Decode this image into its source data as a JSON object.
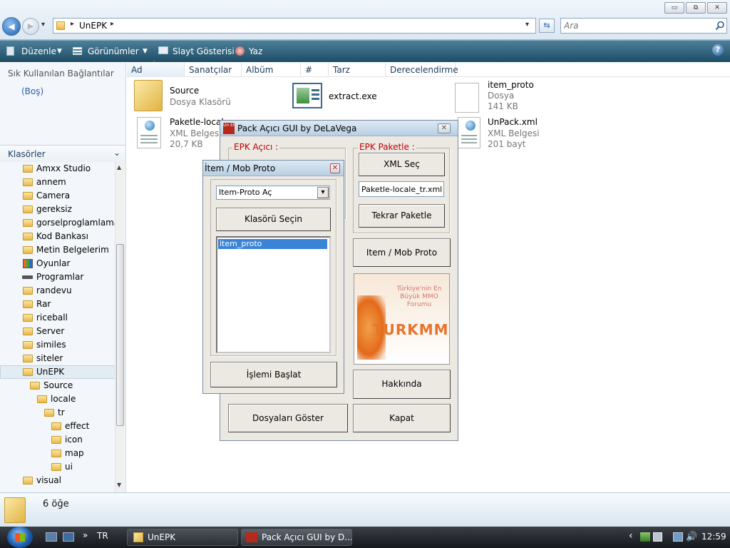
{
  "explorer": {
    "window_controls": {
      "minimize": "▭",
      "maximize": "⧉",
      "close": "✕"
    },
    "nav": {
      "back": "◀",
      "forward": "▶",
      "history": "▾",
      "refresh": "⇆"
    },
    "address": {
      "folder_icon": "folder-icon",
      "path": "UnEPK",
      "chevron": "▸"
    },
    "search": {
      "placeholder": "Ara"
    },
    "toolbar": {
      "organize": "Düzenle",
      "views": "Görünümler",
      "slideshow": "Slayt Gösterisi",
      "print": "Yaz",
      "help": "?"
    },
    "sidebar": {
      "favorites_title": "Sık Kullanılan Bağlantılar",
      "favorites_empty": "(Boş)",
      "folders_title": "Klasörler",
      "tree": [
        {
          "label": "Amxx Studio"
        },
        {
          "label": "annem"
        },
        {
          "label": "Camera"
        },
        {
          "label": "gereksiz"
        },
        {
          "label": "gorselproglamlama"
        },
        {
          "label": "Kod Bankası"
        },
        {
          "label": "Metin Belgelerim"
        },
        {
          "label": "Oyunlar"
        },
        {
          "label": "Programlar"
        },
        {
          "label": "randevu"
        },
        {
          "label": "Rar"
        },
        {
          "label": "riceball"
        },
        {
          "label": "Server"
        },
        {
          "label": "similes"
        },
        {
          "label": "siteler"
        },
        {
          "label": "UnEPK"
        },
        {
          "label": "Source"
        },
        {
          "label": "locale"
        },
        {
          "label": "tr"
        },
        {
          "label": "effect"
        },
        {
          "label": "icon"
        },
        {
          "label": "map"
        },
        {
          "label": "ui"
        },
        {
          "label": "visual"
        }
      ]
    },
    "columns": [
      "Ad",
      "Sanatçılar",
      "Albüm",
      "#",
      "Tarz",
      "Derecelendirme"
    ],
    "files": [
      {
        "name": "Source",
        "type": "Dosya Klasörü",
        "size": ""
      },
      {
        "name": "extract.exe",
        "type": "",
        "size": ""
      },
      {
        "name": "item_proto",
        "type": "Dosya",
        "size": "141 KB"
      },
      {
        "name": "Paketle-locale",
        "type": "XML Belgesi",
        "size": "20,7 KB"
      },
      {
        "name": "UnPack.xml",
        "type": "XML Belgesi",
        "size": "201 bayt"
      }
    ],
    "status": {
      "count": "6 öğe"
    }
  },
  "pack_dialog": {
    "title": "Pack Açıcı GUI by DeLaVega",
    "icon_text": "Un EPK",
    "close": "✕",
    "epk_open_label": "EPK Açıcı :",
    "epk_pack_label": "EPK Paketle :",
    "xml_select": "XML Seç",
    "xml_field": "Paketle-locale_tr.xml",
    "repack": "Tekrar Paketle",
    "item_mob": "Item / Mob Proto",
    "banner": {
      "top": "Türkiye'nin En Büyük MMO Forumu",
      "brand": "TURKMMO"
    },
    "about": "Hakkında",
    "show_files": "Dosyaları Göster",
    "close_btn": "Kapat"
  },
  "proto_dialog": {
    "title": "İtem / Mob Proto",
    "close": "✕",
    "combo_value": "Item-Proto Aç",
    "combo_arrow": "▾",
    "select_folder": "Klasörü Seçin",
    "list_items": [
      "item_proto"
    ],
    "start": "İşlemi Başlat"
  },
  "taskbar": {
    "start_icon": "windows-orb-icon",
    "quick_more": "»",
    "lang": "TR",
    "tasks": [
      {
        "label": "UnEPK"
      },
      {
        "label": "Pack Açıcı GUI by D..."
      }
    ],
    "tray_arrow": "‹",
    "time": "12:59"
  }
}
